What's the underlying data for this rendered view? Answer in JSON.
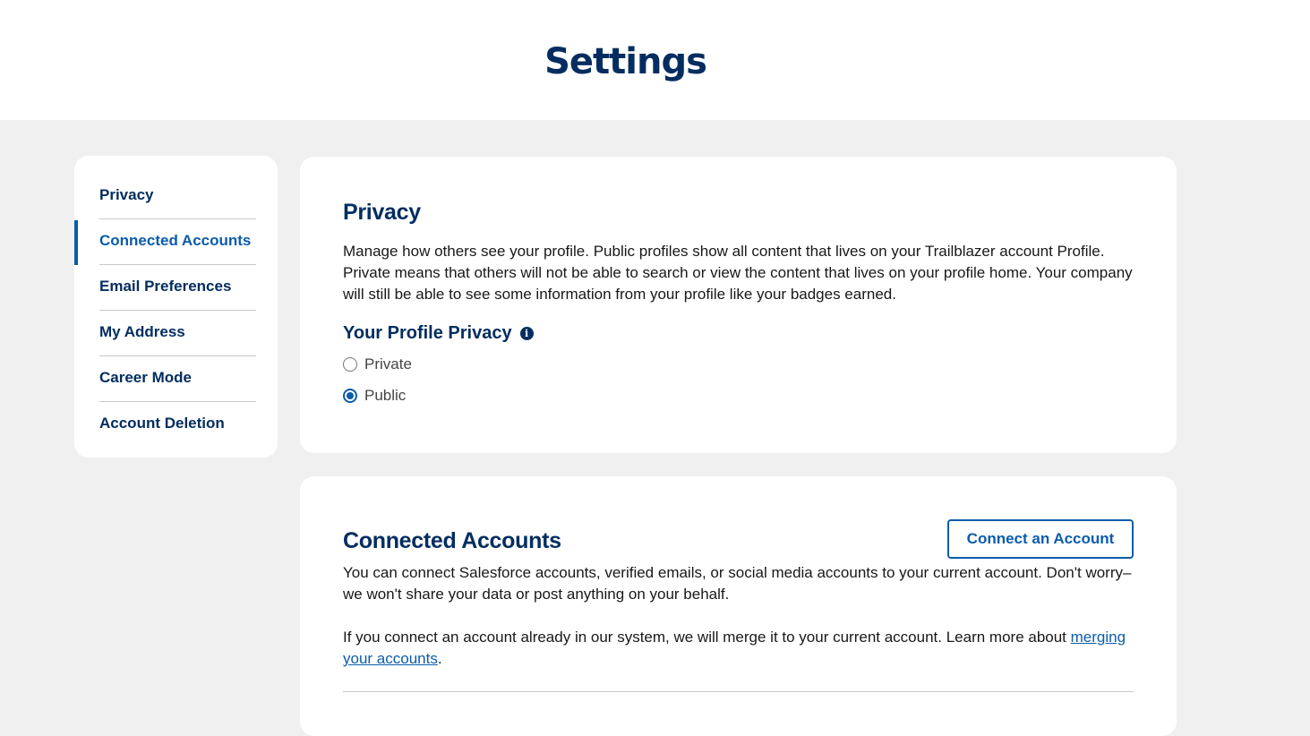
{
  "header": {
    "title": "Settings"
  },
  "sidebar": {
    "items": [
      {
        "label": "Privacy"
      },
      {
        "label": "Connected Accounts"
      },
      {
        "label": "Email Preferences"
      },
      {
        "label": "My Address"
      },
      {
        "label": "Career Mode"
      },
      {
        "label": "Account Deletion"
      }
    ],
    "active": "Connected Accounts"
  },
  "privacy": {
    "title": "Privacy",
    "description": "Manage how others see your profile. Public profiles show all content that lives on your Trailblazer account Profile. Private means that others will not be able to search or view the content that lives on your profile home. Your company will still be able to see some information from your profile like your badges earned.",
    "profile_privacy_label": "Your Profile Privacy",
    "info_icon": "info-icon",
    "options": [
      {
        "label": "Private",
        "checked": false
      },
      {
        "label": "Public",
        "checked": true
      }
    ]
  },
  "connected_accounts": {
    "title": "Connected Accounts",
    "connect_button": "Connect an Account",
    "description": "You can connect Salesforce accounts, verified emails, or social media accounts to your current account. Don't worry–we won't share your data or post anything on your behalf.",
    "merge_text": "If you connect an account already in our system, we will merge it to your current account. Learn more about ",
    "merge_link": "merging your accounts",
    "merge_suffix": "."
  },
  "colors": {
    "brand_dark": "#032d60",
    "accent_blue": "#0b5cab",
    "page_background": "#f0f0f0"
  }
}
